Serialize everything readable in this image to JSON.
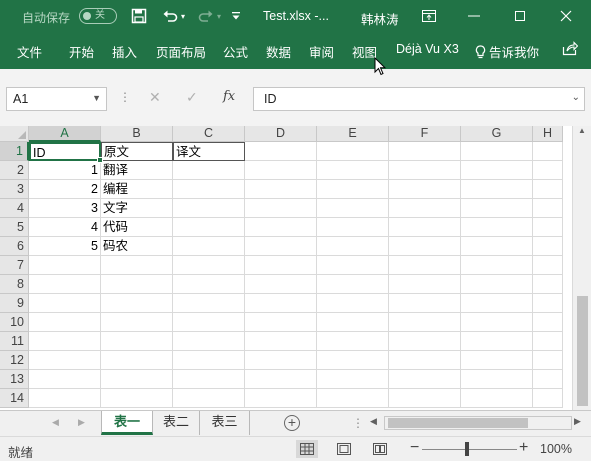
{
  "titlebar": {
    "autosave_label": "自动保存",
    "autosave_state": "关",
    "filename": "Test.xlsx  -...",
    "user": "韩林涛"
  },
  "ribbon": {
    "tabs": [
      "文件",
      "开始",
      "插入",
      "页面布局",
      "公式",
      "数据",
      "审阅",
      "视图",
      "Déjà Vu X3"
    ],
    "tell_me": "告诉我你"
  },
  "formula_bar": {
    "name_box": "A1",
    "formula": "ID",
    "fx_label": "fx"
  },
  "grid": {
    "columns": [
      "A",
      "B",
      "C",
      "D",
      "E",
      "F",
      "G",
      "H"
    ],
    "rows": [
      "1",
      "2",
      "3",
      "4",
      "5",
      "6",
      "7",
      "8",
      "9",
      "10",
      "11",
      "12",
      "13",
      "14"
    ],
    "header_row": [
      "ID",
      "原文",
      "译文"
    ],
    "data": [
      {
        "id": "1",
        "text": "翻译"
      },
      {
        "id": "2",
        "text": "编程"
      },
      {
        "id": "3",
        "text": "文字"
      },
      {
        "id": "4",
        "text": "代码"
      },
      {
        "id": "5",
        "text": "码农"
      }
    ]
  },
  "sheets": {
    "tabs": [
      "表一",
      "表二",
      "表三"
    ],
    "active": "表一"
  },
  "status": {
    "ready": "就绪",
    "zoom": "100%"
  },
  "colors": {
    "accent": "#217346"
  }
}
